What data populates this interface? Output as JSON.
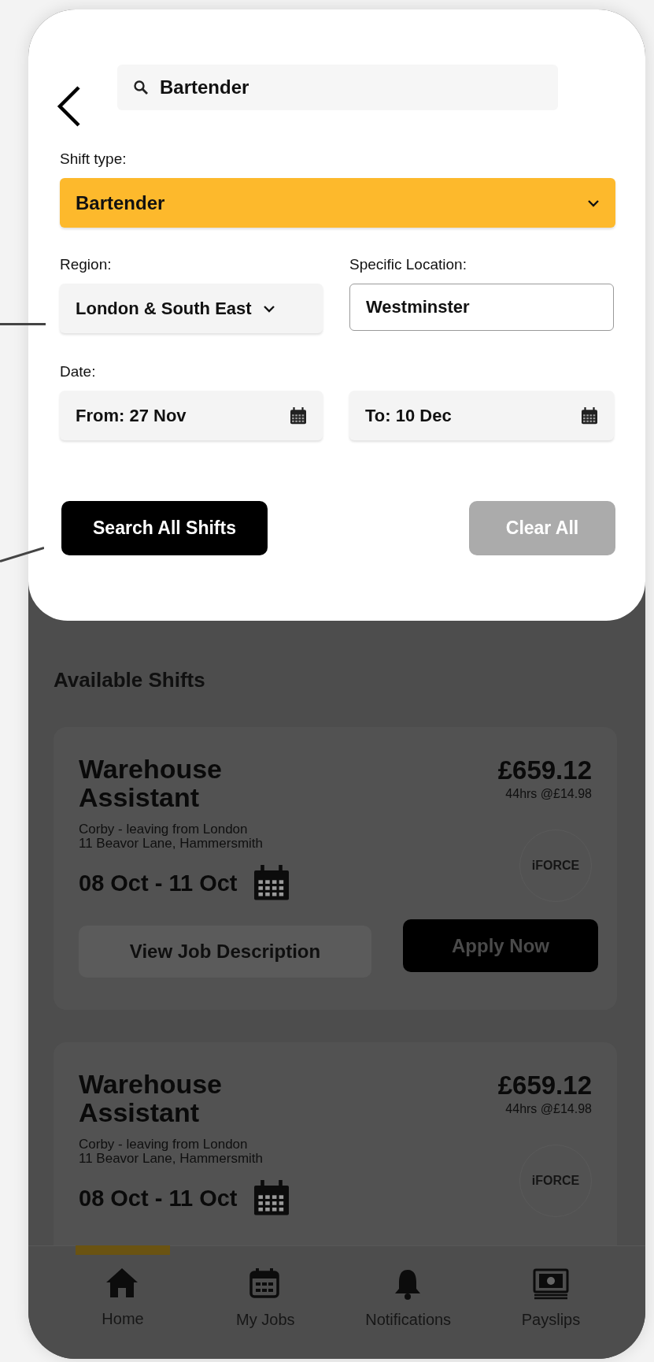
{
  "search": {
    "value": "Bartender"
  },
  "shift_type": {
    "label": "Shift type:",
    "value": "Bartender"
  },
  "region": {
    "label": "Region:",
    "value": "London & South East"
  },
  "location": {
    "label": "Specific Location:",
    "value": "Westminster"
  },
  "date": {
    "label": "Date:",
    "from": "From: 27 Nov",
    "to": "To: 10 Dec"
  },
  "actions": [
    {
      "label": "Search All Shifts",
      "kind": "primary"
    },
    {
      "label": "Clear All",
      "kind": "secondary"
    }
  ],
  "section_title": "Available Shifts",
  "shifts": [
    {
      "title": "Warehouse Assistant",
      "pay": "£659.12",
      "rate": "44hrs @£14.98",
      "location": "Corby - leaving from London",
      "address": "11 Beavor Lane, Hammersmith",
      "dates": "08 Oct - 11 Oct",
      "logo": "iFORCE",
      "buttons": [
        {
          "label": "View Job Description",
          "kind": "secondary"
        },
        {
          "label": "Apply Now",
          "kind": "primary"
        }
      ]
    },
    {
      "title": "Warehouse Assistant",
      "pay": "£659.12",
      "rate": "44hrs @£14.98",
      "location": "Corby - leaving from London",
      "address": "11 Beavor Lane, Hammersmith",
      "dates": "08 Oct - 11 Oct",
      "logo": "iFORCE"
    }
  ],
  "nav": [
    {
      "label": "Home",
      "kind": "home",
      "selected": true
    },
    {
      "label": "My Jobs",
      "kind": "calendar",
      "selected": false
    },
    {
      "label": "Notifications",
      "kind": "bell",
      "selected": false
    },
    {
      "label": "Payslips",
      "kind": "payslip",
      "selected": false
    }
  ]
}
